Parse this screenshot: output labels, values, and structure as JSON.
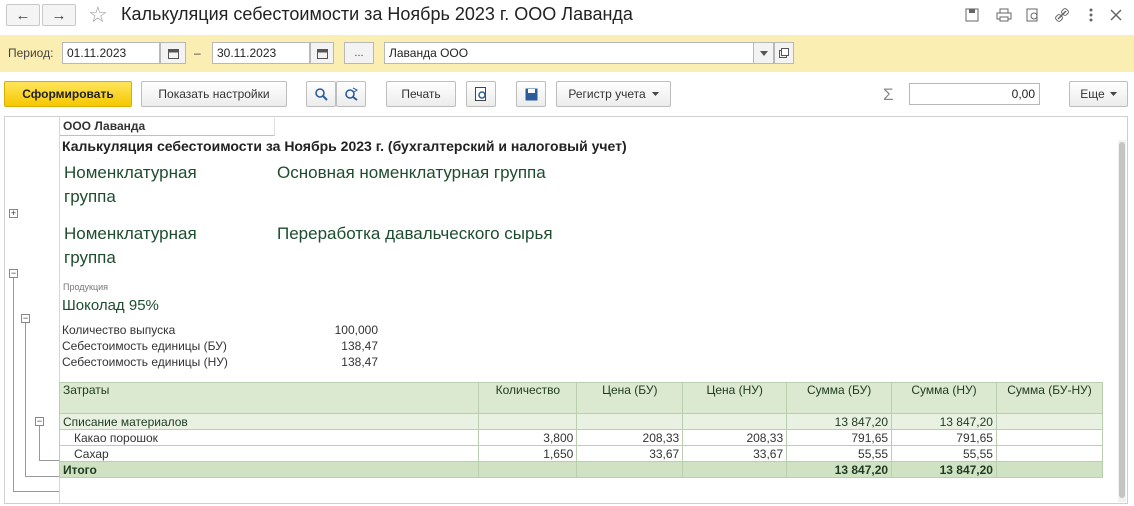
{
  "window": {
    "title": "Калькуляция себестоимости за Ноябрь 2023 г. ООО Лаванда",
    "back_icon": "←",
    "forward_icon": "→",
    "star_icon": "☆"
  },
  "period": {
    "label": "Период:",
    "from": "01.11.2023",
    "dash": "–",
    "to": "30.11.2023",
    "more": "...",
    "org": "Лаванда ООО"
  },
  "toolbar": {
    "generate": "Сформировать",
    "show_settings": "Показать настройки",
    "print": "Печать",
    "register": "Регистр учета",
    "sum_value": "0,00",
    "more": "Еще"
  },
  "report": {
    "org_cell": "ООО Лаванда",
    "heading": "Калькуляция себестоимости за Ноябрь 2023 г. (бухгалтерский и налоговый учет)",
    "group1_label": "Номенклатурная группа",
    "group1_value": "Основная номенклатурная группа",
    "group2_label": "Номенклатурная группа",
    "group2_value": "Переработка давальческого сырья",
    "product_caption": "Продукция",
    "product_name": "Шоколад 95%",
    "params": [
      {
        "label": "Количество выпуска",
        "value": "100,000"
      },
      {
        "label": "Себестоимость единицы (БУ)",
        "value": "138,47"
      },
      {
        "label": "Себестоимость единицы (НУ)",
        "value": "138,47"
      }
    ],
    "columns": [
      "Затраты",
      "Количество",
      "Цена (БУ)",
      "Цена (НУ)",
      "Сумма (БУ)",
      "Сумма (НУ)",
      "Сумма (БУ-НУ)"
    ],
    "group_row": [
      "Списание материалов",
      "",
      "",
      "",
      "13 847,20",
      "13 847,20",
      ""
    ],
    "rows": [
      [
        "Какао порошок",
        "3,800",
        "208,33",
        "208,33",
        "791,65",
        "791,65",
        ""
      ],
      [
        "Сахар",
        "1,650",
        "33,67",
        "33,67",
        "55,55",
        "55,55",
        ""
      ]
    ],
    "total_row": [
      "Итого",
      "",
      "",
      "",
      "13 847,20",
      "13 847,20",
      ""
    ]
  }
}
